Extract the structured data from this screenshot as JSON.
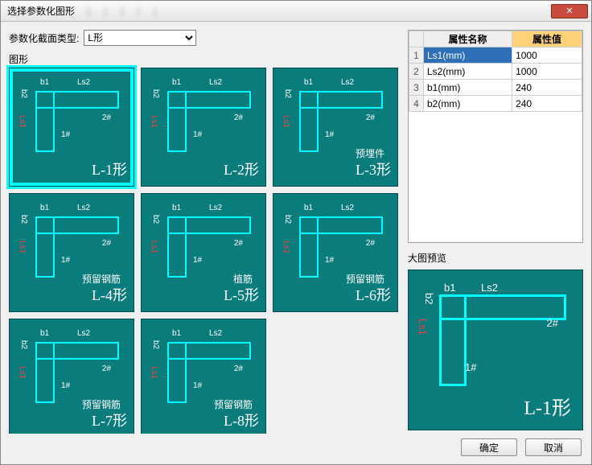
{
  "window": {
    "title": "选择参数化图形"
  },
  "type_row": {
    "label": "参数化截面类型:",
    "selected": "L形",
    "options": [
      "L形"
    ]
  },
  "shapes_label": "图形",
  "shapes": [
    {
      "caption": "L-1形",
      "sub": "",
      "selected": true
    },
    {
      "caption": "L-2形",
      "sub": ""
    },
    {
      "caption": "L-3形",
      "sub": "预埋件"
    },
    {
      "caption": "L-4形",
      "sub": "预留钢筋"
    },
    {
      "caption": "L-5形",
      "sub": "植筋"
    },
    {
      "caption": "L-6形",
      "sub": "预留钢筋"
    },
    {
      "caption": "L-7形",
      "sub": "预留钢筋"
    },
    {
      "caption": "L-8形",
      "sub": "预留钢筋"
    }
  ],
  "schematic_labels": {
    "b1": "b1",
    "ls2": "Ls2",
    "ls1": "Ls1",
    "b2": "b2",
    "n1": "1#",
    "n2": "2#"
  },
  "prop_header": {
    "name": "属性名称",
    "value": "属性值"
  },
  "props": [
    {
      "n": "1",
      "name": "Ls1(mm)",
      "value": "1000",
      "selected": true
    },
    {
      "n": "2",
      "name": "Ls2(mm)",
      "value": "1000"
    },
    {
      "n": "3",
      "name": "b1(mm)",
      "value": "240"
    },
    {
      "n": "4",
      "name": "b2(mm)",
      "value": "240"
    }
  ],
  "preview": {
    "label": "大图预览",
    "caption": "L-1形"
  },
  "buttons": {
    "ok": "确定",
    "cancel": "取消",
    "close": "✕"
  }
}
